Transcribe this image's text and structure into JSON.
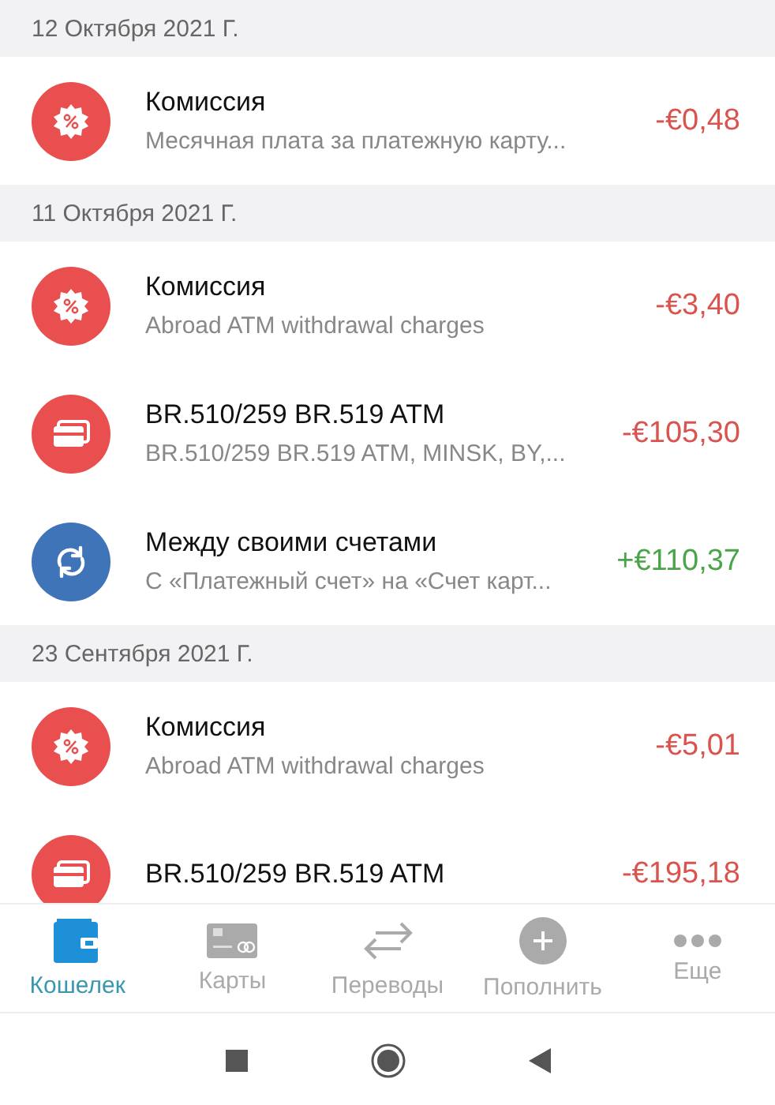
{
  "sections": [
    {
      "date": "12 Октября 2021 Г.",
      "transactions": [
        {
          "kind": "fee",
          "title": "Комиссия",
          "subtitle": "Месячная плата за платежную карту...",
          "amount": "-€0,48",
          "color": "#d9534f"
        }
      ]
    },
    {
      "date": "11 Октября 2021 Г.",
      "transactions": [
        {
          "kind": "fee",
          "title": "Комиссия",
          "subtitle": "Abroad  ATM withdrawal charges",
          "amount": "-€3,40",
          "color": "#d9534f"
        },
        {
          "kind": "card",
          "title": "BR.510/259 BR.519 ATM",
          "subtitle": "BR.510/259 BR.519 ATM, MINSK, BY,...",
          "amount": "-€105,30",
          "color": "#d9534f"
        },
        {
          "kind": "transfer",
          "title": "Между своими счетами",
          "subtitle": "С «Платежный счет» на «Счет карт...",
          "amount": "+€110,37",
          "color": "#4aa54a"
        }
      ]
    },
    {
      "date": "23 Сентября 2021 Г.",
      "transactions": [
        {
          "kind": "fee",
          "title": "Комиссия",
          "subtitle": "Abroad  ATM withdrawal charges",
          "amount": "-€5,01",
          "color": "#d9534f"
        },
        {
          "kind": "card",
          "title": "BR.510/259 BR.519 ATM",
          "amount": "-€195,18",
          "color": "#d9534f"
        }
      ]
    }
  ],
  "tab_bar": [
    {
      "kind": "wallet",
      "label": "Кошелек",
      "selected": true
    },
    {
      "kind": "cards",
      "label": "Карты",
      "selected": false
    },
    {
      "kind": "transfers",
      "label": "Переводы",
      "selected": false
    },
    {
      "kind": "topup",
      "label": "Пополнить",
      "selected": false
    },
    {
      "kind": "more",
      "label": "Еще",
      "selected": false
    }
  ]
}
